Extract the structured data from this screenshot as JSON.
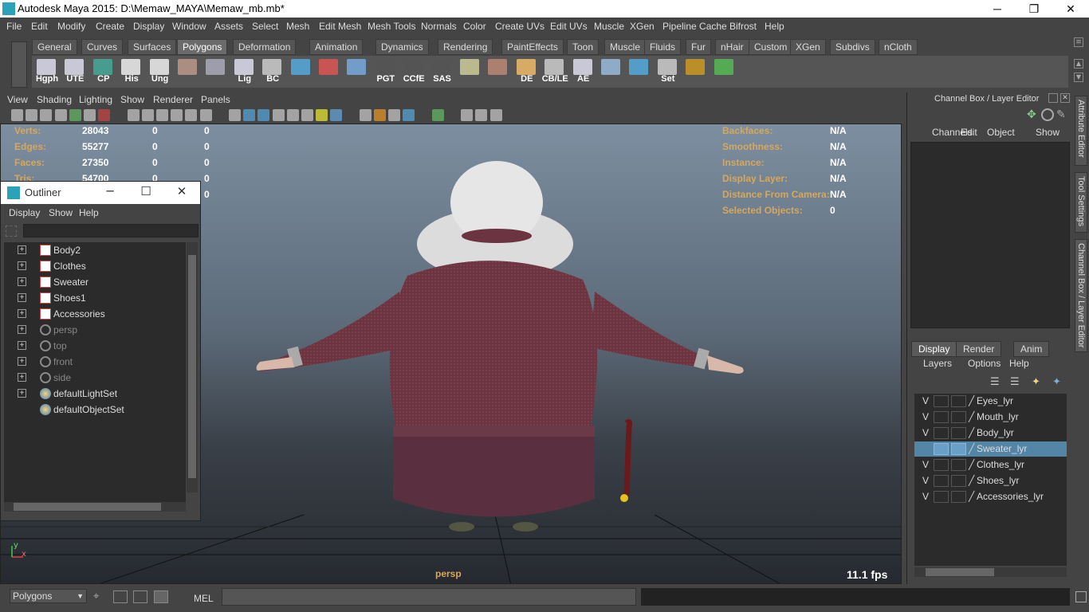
{
  "window": {
    "title": "Autodesk Maya 2015: D:\\Memaw_MAYA\\Memaw_mb.mb*",
    "minimize": "─",
    "maximize": "❐",
    "close": "✕"
  },
  "menubar": [
    "File",
    "Edit",
    "Modify",
    "Create",
    "Display",
    "Window",
    "Assets",
    "Select",
    "Mesh",
    "Edit Mesh",
    "Mesh Tools",
    "Normals",
    "Color",
    "Create UVs",
    "Edit UVs",
    "Muscle",
    "XGen",
    "Pipeline Cache",
    "Bifrost",
    "Help"
  ],
  "shelf_tabs": [
    "General",
    "Curves",
    "Surfaces",
    "Polygons",
    "Deformation",
    "Animation",
    "Dynamics",
    "Rendering",
    "PaintEffects",
    "Toon",
    "Muscle",
    "Fluids",
    "Fur",
    "nHair",
    "Custom",
    "XGen",
    "Subdivs",
    "nCloth"
  ],
  "shelf_active": "Polygons",
  "shelf_icons": [
    "Hgph",
    "UTE",
    "CP",
    "His",
    "Ung",
    "",
    "",
    "Lig",
    "BC",
    "",
    "",
    "",
    "PGT",
    "CCfE",
    "SAS",
    "",
    "",
    "DE",
    "CB/LE",
    "AE",
    "",
    "",
    "Set",
    "",
    ""
  ],
  "viewport_menu": [
    "View",
    "Shading",
    "Lighting",
    "Show",
    "Renderer",
    "Panels"
  ],
  "hud_left": [
    {
      "label": "Verts:",
      "v1": "28043",
      "v2": "0",
      "v3": "0"
    },
    {
      "label": "Edges:",
      "v1": "55277",
      "v2": "0",
      "v3": "0"
    },
    {
      "label": "Faces:",
      "v1": "27350",
      "v2": "0",
      "v3": "0"
    },
    {
      "label": "Tris:",
      "v1": "54700",
      "v2": "0",
      "v3": "0"
    }
  ],
  "hud_left_extra": "0",
  "hud_right": [
    {
      "label": "Backfaces:",
      "value": "N/A"
    },
    {
      "label": "Smoothness:",
      "value": "N/A"
    },
    {
      "label": "Instance:",
      "value": "N/A"
    },
    {
      "label": "Display Layer:",
      "value": "N/A"
    },
    {
      "label": "Distance From Camera:",
      "value": "N/A"
    },
    {
      "label": "Selected Objects:",
      "value": "0"
    }
  ],
  "camera_label": "persp",
  "fps": "11.1 fps",
  "axis": {
    "x": "x",
    "y": "y"
  },
  "outliner": {
    "title": "Outliner",
    "menu": [
      "Display",
      "Show",
      "Help"
    ],
    "items": [
      {
        "name": "Body2",
        "type": "mesh",
        "dim": false
      },
      {
        "name": "Clothes",
        "type": "mesh",
        "dim": false
      },
      {
        "name": "Sweater",
        "type": "mesh",
        "dim": false
      },
      {
        "name": "Shoes1",
        "type": "mesh",
        "dim": false
      },
      {
        "name": "Accessories",
        "type": "mesh",
        "dim": false
      },
      {
        "name": "persp",
        "type": "camera",
        "dim": true
      },
      {
        "name": "top",
        "type": "camera",
        "dim": true
      },
      {
        "name": "front",
        "type": "camera",
        "dim": true
      },
      {
        "name": "side",
        "type": "camera",
        "dim": true
      },
      {
        "name": "defaultLightSet",
        "type": "set",
        "dim": false
      },
      {
        "name": "defaultObjectSet",
        "type": "set",
        "dim": false
      }
    ]
  },
  "channelbox": {
    "title": "Channel Box / Layer Editor",
    "menu": [
      "Channels",
      "Edit",
      "Object",
      "Show"
    ],
    "layer_tabs": [
      "Display",
      "Render",
      "Anim"
    ],
    "layer_menu": [
      "Layers",
      "Options",
      "Help"
    ],
    "layers": [
      {
        "v": "V",
        "name": "Eyes_lyr",
        "selected": false
      },
      {
        "v": "V",
        "name": "Mouth_lyr",
        "selected": false
      },
      {
        "v": "V",
        "name": "Body_lyr",
        "selected": false
      },
      {
        "v": "",
        "name": "Sweater_lyr",
        "selected": true
      },
      {
        "v": "V",
        "name": "Clothes_lyr",
        "selected": false
      },
      {
        "v": "V",
        "name": "Shoes_lyr",
        "selected": false
      },
      {
        "v": "V",
        "name": "Accessories_lyr",
        "selected": false
      }
    ]
  },
  "side_tabs": [
    "Attribute Editor",
    "Tool Settings",
    "Channel Box / Layer Editor"
  ],
  "cmdline": {
    "mode": "Polygons",
    "lang": "MEL"
  },
  "colors": {
    "hud_label": "#d8a75a",
    "sweater": "#6b3440",
    "hair": "#e8e8e8",
    "selected_layer": "#5285a6"
  }
}
